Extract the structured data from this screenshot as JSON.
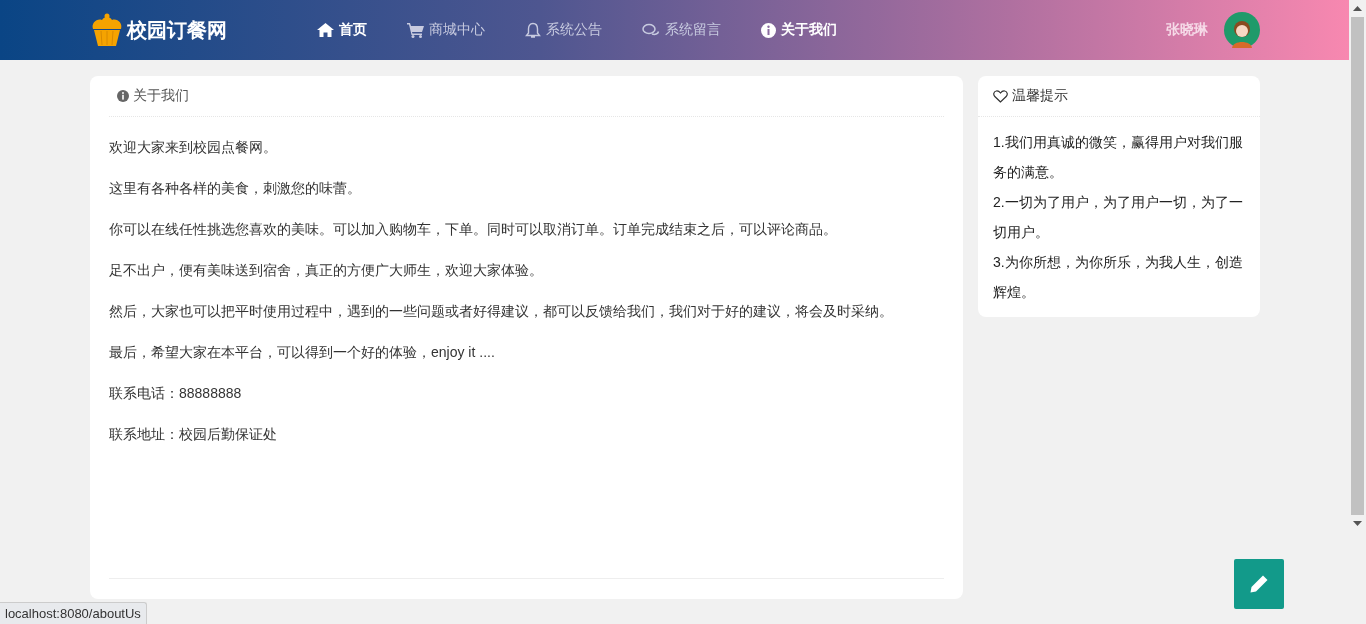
{
  "header": {
    "logo": "校园订餐网",
    "nav": [
      {
        "label": "首页",
        "selected": true
      },
      {
        "label": "商城中心",
        "selected": false
      },
      {
        "label": "系统公告",
        "selected": false
      },
      {
        "label": "系统留言",
        "selected": false
      },
      {
        "label": "关于我们",
        "selected": true
      }
    ],
    "user": {
      "name": "张晓琳"
    }
  },
  "about": {
    "title": "关于我们",
    "paragraphs": [
      "欢迎大家来到校园点餐网。",
      "这里有各种各样的美食，刺激您的味蕾。",
      "你可以在线任性挑选您喜欢的美味。可以加入购物车，下单。同时可以取消订单。订单完成结束之后，可以评论商品。",
      "足不出户，便有美味送到宿舍，真正的方便广大师生，欢迎大家体验。",
      "然后，大家也可以把平时使用过程中，遇到的一些问题或者好得建议，都可以反馈给我们，我们对于好的建议，将会及时采纳。",
      "最后，希望大家在本平台，可以得到一个好的体验，enjoy it ....",
      "联系电话：88888888",
      "联系地址：校园后勤保证处"
    ]
  },
  "tips": {
    "title": "温馨提示",
    "items": [
      "1.我们用真诚的微笑，赢得用户对我们服务的满意。",
      "2.一切为了用户，为了用户一切，为了一切用户。",
      "3.为你所想，为你所乐，为我人生，创造辉煌。"
    ]
  },
  "status_bar": {
    "url": "localhost:8080/aboutUs"
  }
}
